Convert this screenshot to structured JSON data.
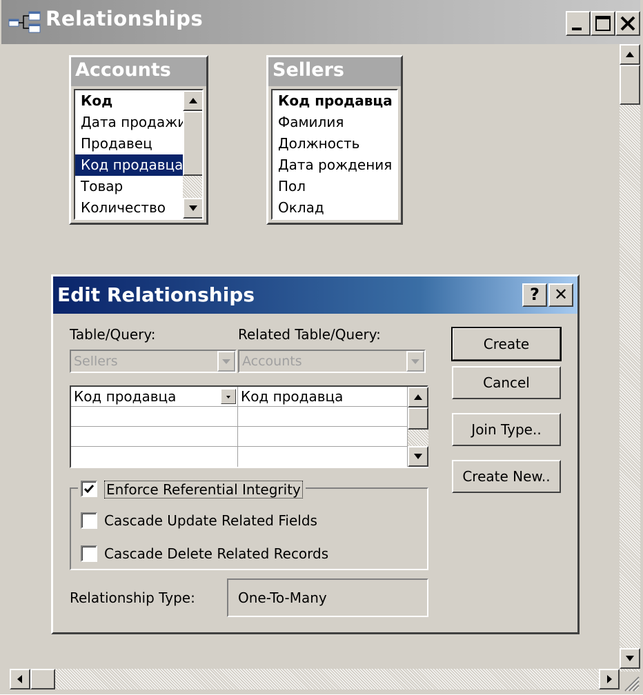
{
  "window": {
    "title": "Relationships"
  },
  "tables": {
    "accounts": {
      "title": "Accounts",
      "fields": [
        {
          "label": "Код",
          "key": true,
          "selected": false
        },
        {
          "label": "Дата продажи",
          "key": false,
          "selected": false
        },
        {
          "label": "Продавец",
          "key": false,
          "selected": false
        },
        {
          "label": "Код продавца",
          "key": false,
          "selected": true
        },
        {
          "label": "Товар",
          "key": false,
          "selected": false
        },
        {
          "label": "Количество",
          "key": false,
          "selected": false
        }
      ]
    },
    "sellers": {
      "title": "Sellers",
      "fields": [
        {
          "label": "Код продавца",
          "key": true
        },
        {
          "label": "Фамилия",
          "key": false
        },
        {
          "label": "Должность",
          "key": false
        },
        {
          "label": "Дата рождения",
          "key": false
        },
        {
          "label": "Пол",
          "key": false
        },
        {
          "label": "Оклад",
          "key": false
        }
      ]
    }
  },
  "dialog": {
    "title": "Edit Relationships",
    "help_label": "?",
    "close_label": "✕",
    "table_query_label": "Table/Query:",
    "related_table_query_label": "Related Table/Query:",
    "table_value": "Sellers",
    "related_table_value": "Accounts",
    "join_rows": [
      {
        "left": "Код продавца",
        "right": "Код продавца"
      },
      {
        "left": "",
        "right": ""
      },
      {
        "left": "",
        "right": ""
      },
      {
        "left": "",
        "right": ""
      }
    ],
    "buttons": {
      "create": "Create",
      "cancel": "Cancel",
      "join_type": "Join Type..",
      "create_new": "Create New.."
    },
    "options": {
      "enforce_integrity": {
        "label": "Enforce Referential Integrity",
        "checked": true
      },
      "cascade_update": {
        "label": "Cascade Update Related Fields",
        "checked": false
      },
      "cascade_delete": {
        "label": "Cascade Delete Related Records",
        "checked": false
      }
    },
    "relationship_type_label": "Relationship Type:",
    "relationship_type_value": "One-To-Many"
  }
}
